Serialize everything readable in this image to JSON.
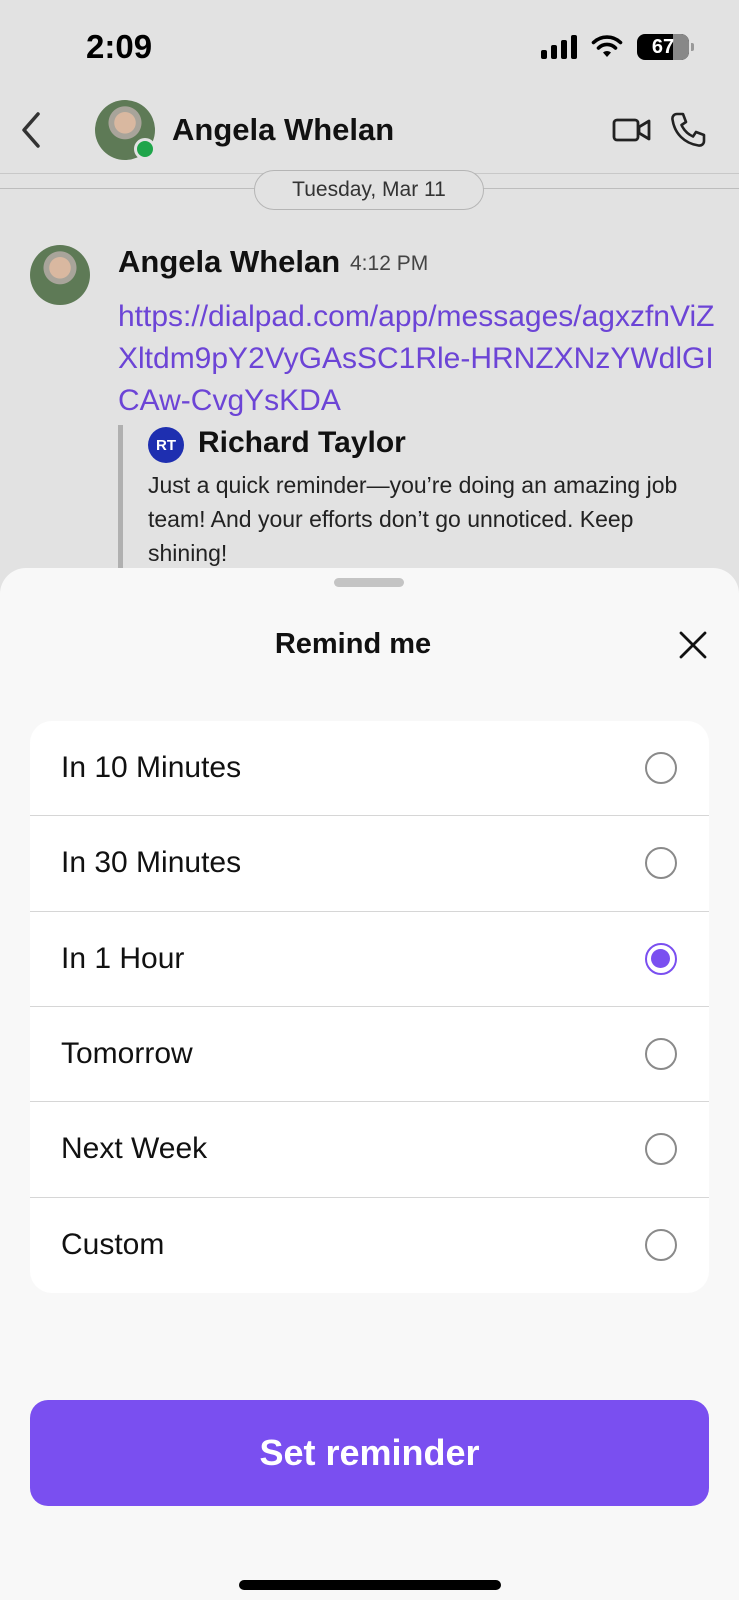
{
  "status_bar": {
    "time": "2:09",
    "battery": "67"
  },
  "header": {
    "contact_name": "Angela Whelan",
    "presence": "online"
  },
  "date_divider": "Tuesday, Mar 11",
  "message": {
    "sender": "Angela Whelan",
    "time": "4:12 PM",
    "link": "https://dialpad.com/app/messages/agxzfnViZXltdm9pY2VyGAsSC1Rle-HRNZXNzYWdlGICAw-CvgYsKDA",
    "quote": {
      "initials": "RT",
      "author": "Richard Taylor",
      "text": "Just a quick reminder—you’re doing an amazing job team! And your efforts don’t go unnoticed. Keep shining!"
    }
  },
  "sheet": {
    "title": "Remind me",
    "options": [
      {
        "label": "In 10 Minutes",
        "selected": false
      },
      {
        "label": "In 30 Minutes",
        "selected": false
      },
      {
        "label": "In 1 Hour",
        "selected": true
      },
      {
        "label": "Tomorrow",
        "selected": false
      },
      {
        "label": "Next Week",
        "selected": false
      },
      {
        "label": "Custom",
        "selected": false
      }
    ],
    "submit_label": "Set reminder"
  },
  "colors": {
    "accent": "#7a4ff0",
    "link": "#6c44d6",
    "presence": "#1fa54a",
    "badge": "#1e2fb0"
  }
}
